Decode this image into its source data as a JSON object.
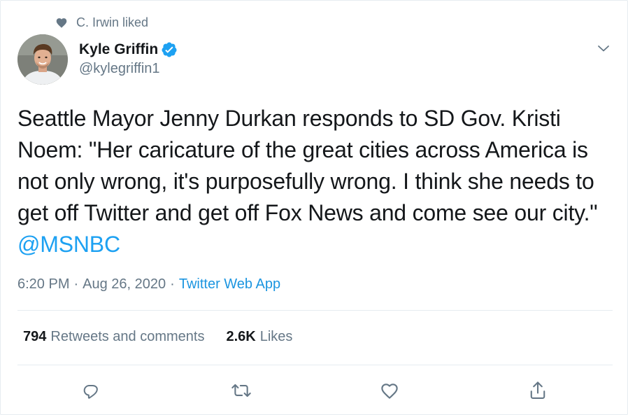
{
  "social_context": {
    "icon": "heart-icon",
    "text": "C. Irwin liked"
  },
  "author": {
    "display_name": "Kyle Griffin",
    "handle": "@kylegriffin1",
    "verified_icon": "verified-badge-icon",
    "avatar_icon": "avatar"
  },
  "menu": {
    "icon": "chevron-down-icon"
  },
  "tweet": {
    "text": "Seattle Mayor Jenny Durkan responds to SD Gov. Kristi Noem: \"Her caricature of the great cities across America is not only wrong, it's purposefully wrong. I think she needs to get off Twitter and get off Fox News and come see our city.\" ",
    "mention": "@MSNBC"
  },
  "meta": {
    "time": "6:20 PM",
    "separator": "·",
    "date": "Aug 26, 2020",
    "source": "Twitter Web App"
  },
  "stats": {
    "retweets_count": "794",
    "retweets_label": "Retweets and comments",
    "likes_count": "2.6K",
    "likes_label": "Likes"
  },
  "actions": [
    {
      "name": "reply",
      "icon": "reply-icon"
    },
    {
      "name": "retweet",
      "icon": "retweet-icon"
    },
    {
      "name": "like",
      "icon": "heart-outline-icon"
    },
    {
      "name": "share",
      "icon": "share-icon"
    }
  ],
  "colors": {
    "accent": "#1da1f2",
    "link": "#1b95e0",
    "text_primary": "#14171a",
    "text_secondary": "#657786",
    "divider": "#e6ecf0",
    "social_icon": "#657786"
  }
}
